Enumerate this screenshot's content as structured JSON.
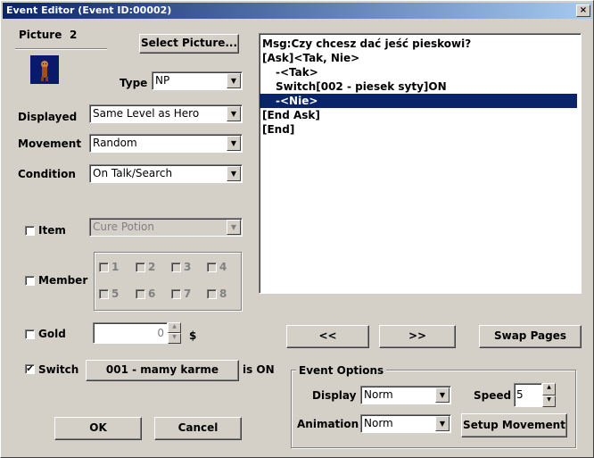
{
  "window": {
    "title": "Event Editor (Event ID:00002)",
    "close_glyph": "×"
  },
  "picture": {
    "label": "Picture",
    "number": "2",
    "select_button": "Select Picture..."
  },
  "type": {
    "label": "Type",
    "value": "NP"
  },
  "displayed": {
    "label": "Displayed",
    "value": "Same Level as Hero"
  },
  "movement": {
    "label": "Movement",
    "value": "Random"
  },
  "condition": {
    "label": "Condition",
    "value": "On Talk/Search"
  },
  "item": {
    "label": "Item",
    "checked": false,
    "value": "Cure Potion"
  },
  "member": {
    "label": "Member",
    "checked": false,
    "slots": [
      "1",
      "2",
      "3",
      "4",
      "5",
      "6",
      "7",
      "8"
    ]
  },
  "gold": {
    "label": "Gold",
    "checked": false,
    "value": "0",
    "unit": "$"
  },
  "switch": {
    "label": "Switch",
    "checked": true,
    "checkmark": "✔",
    "button": "001 - mamy karme",
    "suffix": "is ON"
  },
  "script": {
    "lines": [
      "Msg:Czy chcesz dać jeść pieskowi?",
      "[Ask]<Tak, Nie>",
      "-<Tak>",
      "Switch[002 - piesek syty]ON",
      "-<Nie>",
      "[End Ask]",
      "[End]"
    ],
    "selected_index": 4
  },
  "nav": {
    "prev": "<<",
    "next": ">>",
    "swap": "Swap Pages"
  },
  "event_options": {
    "title": "Event Options",
    "display_label": "Display",
    "display_value": "Norm",
    "speed_label": "Speed",
    "speed_value": "5",
    "animation_label": "Animation",
    "animation_value": "Norm",
    "setup_movement": "Setup Movement"
  },
  "footer": {
    "ok": "OK",
    "cancel": "Cancel"
  },
  "icons": {
    "dropdown_arrow": "▼",
    "spin_up": "▲",
    "spin_down": "▼"
  },
  "colors": {
    "face": "#d4d0c8",
    "titlebar": "#0a246a",
    "selection": "#0a246a"
  }
}
